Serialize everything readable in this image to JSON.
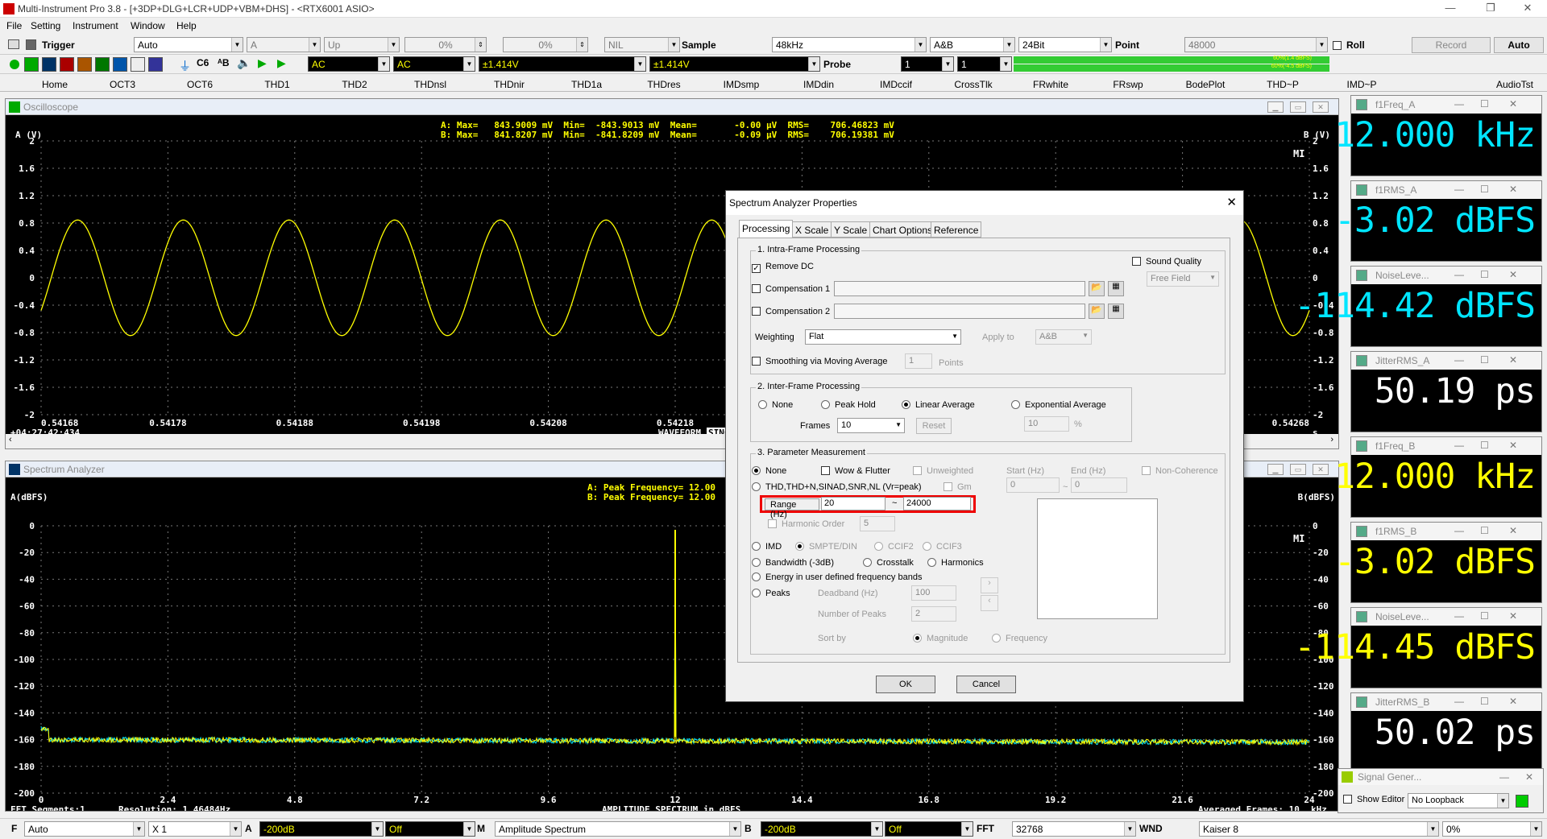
{
  "window": {
    "title": "Multi-Instrument Pro 3.8  -  [+3DP+DLG+LCR+UDP+VBM+DHS]  -  <RTX6001 ASIO>"
  },
  "menu": [
    "File",
    "Setting",
    "Instrument",
    "Window",
    "Help"
  ],
  "toolbar1": {
    "trigger": "Trigger",
    "trigger_mode": "Auto",
    "channel": "A",
    "edge": "Up",
    "pct1": "0%",
    "pct2": "0%",
    "nil": "NIL",
    "sample_label": "Sample",
    "sample_rate": "48kHz",
    "channels": "A&B",
    "bits": "24Bit",
    "point_label": "Point",
    "points": "48000",
    "roll": "Roll",
    "record": "Record",
    "auto": "Auto"
  },
  "toolbar2": {
    "coupling_a": "AC",
    "coupling_b": "AC",
    "range_a": "±1.414V",
    "range_b": "±1.414V",
    "probe_label": "Probe",
    "probe_a": "1",
    "probe_b": "1",
    "level_a": "60%(1.4 dBFS)",
    "level_b": "60%(-4.5 dBFS)"
  },
  "tabs": [
    "Home",
    "OCT3",
    "OCT6",
    "THD1",
    "THD2",
    "THDnsl",
    "THDnir",
    "THD1a",
    "THDres",
    "IMDsmp",
    "IMDdin",
    "IMDccif",
    "CrossTlk",
    "FRwhite",
    "FRswp",
    "BodePlot",
    "THD~P",
    "IMD~P",
    "AudioTst"
  ],
  "oscilloscope": {
    "title": "Oscilloscope",
    "y_left": "A (V)",
    "y_right": "B (V)",
    "stats_a": "A: Max=   843.9009 mV  Min=  -843.9013 mV  Mean=       -0.00 µV  RMS=    706.46823 mV",
    "stats_b": "B: Max=   841.8207 mV  Min=  -841.8209 mV  Mean=       -0.09 µV  RMS=    706.19381 mV",
    "y_ticks": [
      "2",
      "1.6",
      "1.2",
      "0.8",
      "0.4",
      "0",
      "-0.4",
      "-0.8",
      "-1.2",
      "-1.6",
      "-2"
    ],
    "x_ticks": [
      "0.54168",
      "0.54178",
      "0.54188",
      "0.54198",
      "0.54208",
      "0.54218",
      "0.54268"
    ],
    "time_offset": "+04:27:42:434",
    "bottom_label": "WAVEFORM",
    "sinc": "SINC",
    "unit": "s",
    "mi": "MI"
  },
  "spectrum": {
    "title": "Spectrum Analyzer",
    "y_left": "A(dBFS)",
    "y_right": "B(dBFS)",
    "peak_a": "A: Peak Frequency= 12.00",
    "peak_b": "B: Peak Frequency= 12.00",
    "y_ticks": [
      "0",
      "-20",
      "-40",
      "-60",
      "-80",
      "-100",
      "-120",
      "-140",
      "-160",
      "-180",
      "-200"
    ],
    "x_ticks": [
      "0",
      "2.4",
      "4.8",
      "7.2",
      "9.6",
      "12",
      "14.4",
      "16.8",
      "19.2",
      "21.6",
      "24"
    ],
    "fft_segments": "FFT Segments:1",
    "resolution": "Resolution: 1.46484Hz",
    "center_label": "AMPLITUDE SPECTRUM in dBFS",
    "avg_frames": "Averaged Frames: 10",
    "unit": "kHz",
    "mi": "MI"
  },
  "meters": [
    {
      "title": "f1Freq_A",
      "value": "12.000 kHz",
      "color": "#00e5ff"
    },
    {
      "title": "f1RMS_A",
      "value": "-3.02 dBFS",
      "color": "#00e5ff"
    },
    {
      "title": "NoiseLeve...",
      "value": "-114.42 dBFS",
      "color": "#00e5ff"
    },
    {
      "title": "JitterRMS_A",
      "value": "50.19 ps",
      "color": "#ffffff"
    },
    {
      "title": "f1Freq_B",
      "value": "12.000 kHz",
      "color": "#ffff00"
    },
    {
      "title": "f1RMS_B",
      "value": "-3.02 dBFS",
      "color": "#ffff00"
    },
    {
      "title": "NoiseLeve...",
      "value": "-114.45 dBFS",
      "color": "#ffff00"
    },
    {
      "title": "JitterRMS_B",
      "value": "50.02 ps",
      "color": "#ffffff"
    }
  ],
  "signal_gen": {
    "title": "Signal Gener...",
    "show_editor": "Show Editor",
    "loopback": "No Loopback"
  },
  "dialog": {
    "title": "Spectrum Analyzer Properties",
    "tabs": [
      "Processing",
      "X Scale",
      "Y Scale",
      "Chart Options",
      "Reference"
    ],
    "g1": "1. Intra-Frame Processing",
    "remove_dc": "Remove DC",
    "sound_quality": "Sound Quality",
    "free_field": "Free Field",
    "comp1": "Compensation 1",
    "comp2": "Compensation 2",
    "weighting_label": "Weighting",
    "weighting": "Flat",
    "apply_to": "Apply to",
    "apply_val": "A&B",
    "smoothing": "Smoothing via Moving Average",
    "smooth_pts": "1",
    "points": "Points",
    "g2": "2. Inter-Frame Processing",
    "none": "None",
    "peak_hold": "Peak Hold",
    "linear_avg": "Linear Average",
    "exp_avg": "Exponential Average",
    "frames_label": "Frames",
    "frames": "10",
    "reset": "Reset",
    "pct_val": "10",
    "pct": "%",
    "g3": "3. Parameter Measurement",
    "none3": "None",
    "wow": "Wow & Flutter",
    "unweighted": "Unweighted",
    "start_hz": "Start (Hz)",
    "end_hz": "End (Hz)",
    "noncoh": "Non-Coherence",
    "thd": "THD,THD+N,SINAD,SNR,NL (Vr=peak)",
    "gm": "Gm",
    "start_val": "0",
    "end_val": "0",
    "tilde": "~",
    "range_label": "Range (Hz)",
    "range_from": "20",
    "range_to": "24000",
    "harm_order": "Harmonic Order",
    "harm_val": "5",
    "imd": "IMD",
    "smpte": "SMPTE/DIN",
    "ccif2": "CCIF2",
    "ccif3": "CCIF3",
    "bw": "Bandwidth (-3dB)",
    "crosstalk": "Crosstalk",
    "harmonics": "Harmonics",
    "energy": "Energy in user defined frequency bands",
    "peaks": "Peaks",
    "deadband": "Deadband (Hz)",
    "deadband_val": "100",
    "num_peaks": "Number of Peaks",
    "num_peaks_val": "2",
    "sort_by": "Sort by",
    "magnitude": "Magnitude",
    "frequency": "Frequency",
    "ok": "OK",
    "cancel": "Cancel"
  },
  "bottom": {
    "f_label": "F",
    "f_mode": "Auto",
    "x1": "X 1",
    "a_label": "A",
    "a_min": "-200dB",
    "a_off": "Off",
    "m_label": "M",
    "m_mode": "Amplitude Spectrum",
    "b_label": "B",
    "b_min": "-200dB",
    "b_off": "Off",
    "fft_label": "FFT",
    "fft_size": "32768",
    "wnd_label": "WND",
    "window": "Kaiser 8",
    "overlap": "0%"
  }
}
